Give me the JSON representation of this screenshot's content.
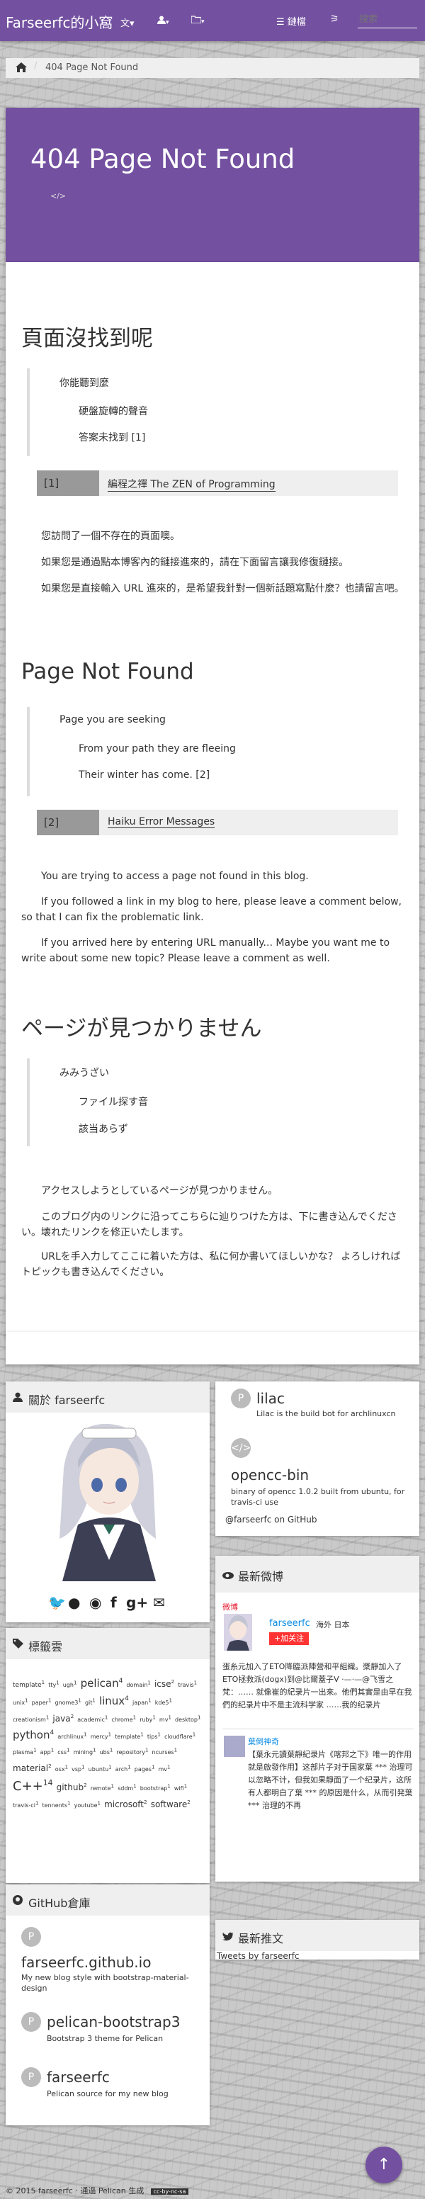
{
  "nav": {
    "brand": "Farseerfc的小窩",
    "lang_icon": "translate-icon",
    "user_icon": "user-icon",
    "folder_icon": "folder-icon",
    "links_label": "鏈檔",
    "search_placeholder": "搜索"
  },
  "breadcrumb": {
    "home_icon": "home-icon",
    "current": "404 Page Not Found"
  },
  "header": {
    "title": "404 Page Not Found",
    "code_icon": "</>"
  },
  "article": {
    "zh": {
      "heading": "頁面沒找到呢",
      "poem": [
        "你能聽到麼",
        "硬盤旋轉的聲音",
        "答案未找到 [1]"
      ],
      "footnote_num": "[1]",
      "footnote_text": "編程之禪 The ZEN of Programming",
      "paras": [
        "您訪問了一個不存在的頁面噢。",
        "如果您是通過點本博客內的鏈接進來的，請在下面留言讓我修復鏈接。",
        "如果您是直接輸入 URL 進來的，是希望我針對一個新話題寫點什麼？也請留言吧。"
      ]
    },
    "en": {
      "heading": "Page Not Found",
      "poem": [
        "Page you are seeking",
        "From your path they are fleeing",
        "Their winter has come. [2]"
      ],
      "footnote_num": "[2]",
      "footnote_text": "Haiku Error Messages",
      "paras": [
        "You are trying to access a page not found in this blog.",
        "If you followed a link in my blog to here, please leave a comment below, so that I can fix the problematic link.",
        "If you arrived here by entering URL manually... Maybe you want me to write about some new topic? Please leave a comment as well."
      ]
    },
    "ja": {
      "heading": "ページが見つかりません",
      "poem": [
        "みみうざい",
        "ファイル探す音",
        "該当あらず"
      ],
      "paras": [
        "アクセスしようとしているページが見つかりません。",
        "このブログ内のリンクに沿ってこちらに辿りつけた方は、下に書き込んでください。壊れたリンクを修正いたします。",
        "URLを手入力してここに着いた方は、私に何か書いてほしいかな？ よろしければトピックも書き込んでください。"
      ]
    }
  },
  "about": {
    "title": "關於 farseerfc",
    "social": [
      "twitter-icon",
      "github-icon",
      "weibo-icon",
      "facebook-icon",
      "google-plus-icon",
      "email-icon"
    ]
  },
  "tags": {
    "title": "標籤雲",
    "items": [
      {
        "t": "template",
        "n": "1",
        "s": 9
      },
      {
        "t": "tty",
        "n": "1",
        "s": 8
      },
      {
        "t": "ugh",
        "n": "1",
        "s": 8
      },
      {
        "t": "pelican",
        "n": "4",
        "s": 15
      },
      {
        "t": "domain",
        "n": "1",
        "s": 8
      },
      {
        "t": "icse",
        "n": "2",
        "s": 12
      },
      {
        "t": "travis",
        "n": "1",
        "s": 8
      },
      {
        "t": "unix",
        "n": "1",
        "s": 8
      },
      {
        "t": "paper",
        "n": "1",
        "s": 8
      },
      {
        "t": "gnome3",
        "n": "1",
        "s": 8
      },
      {
        "t": "git",
        "n": "1",
        "s": 8
      },
      {
        "t": "linux",
        "n": "4",
        "s": 15
      },
      {
        "t": "japan",
        "n": "1",
        "s": 8
      },
      {
        "t": "kde5",
        "n": "1",
        "s": 8
      },
      {
        "t": "creationism",
        "n": "1",
        "s": 8
      },
      {
        "t": "java",
        "n": "2",
        "s": 12
      },
      {
        "t": "academic",
        "n": "1",
        "s": 8
      },
      {
        "t": "chrome",
        "n": "1",
        "s": 8
      },
      {
        "t": "ruby",
        "n": "1",
        "s": 8
      },
      {
        "t": "mv",
        "n": "1",
        "s": 8
      },
      {
        "t": "desktop",
        "n": "1",
        "s": 8
      },
      {
        "t": "python",
        "n": "4",
        "s": 15
      },
      {
        "t": "archlinux",
        "n": "1",
        "s": 8
      },
      {
        "t": "mercy",
        "n": "1",
        "s": 8
      },
      {
        "t": "template",
        "n": "1",
        "s": 8
      },
      {
        "t": "tips",
        "n": "1",
        "s": 8
      },
      {
        "t": "cloudflare",
        "n": "1",
        "s": 8
      },
      {
        "t": "plasma",
        "n": "1",
        "s": 8
      },
      {
        "t": "app",
        "n": "1",
        "s": 8
      },
      {
        "t": "css",
        "n": "1",
        "s": 8
      },
      {
        "t": "mining",
        "n": "1",
        "s": 8
      },
      {
        "t": "ubs",
        "n": "1",
        "s": 8
      },
      {
        "t": "repository",
        "n": "1",
        "s": 8
      },
      {
        "t": "ncurses",
        "n": "1",
        "s": 8
      },
      {
        "t": "material",
        "n": "2",
        "s": 12
      },
      {
        "t": "osx",
        "n": "1",
        "s": 8
      },
      {
        "t": "vsp",
        "n": "1",
        "s": 8
      },
      {
        "t": "ubuntu",
        "n": "1",
        "s": 8
      },
      {
        "t": "arch",
        "n": "1",
        "s": 8
      },
      {
        "t": "pages",
        "n": "1",
        "s": 8
      },
      {
        "t": "mv",
        "n": "1",
        "s": 8
      },
      {
        "t": "C++",
        "n": "14",
        "s": 18
      },
      {
        "t": "github",
        "n": "2",
        "s": 12
      },
      {
        "t": "remote",
        "n": "1",
        "s": 8
      },
      {
        "t": "sddm",
        "n": "1",
        "s": 8
      },
      {
        "t": "bootstrap",
        "n": "1",
        "s": 8
      },
      {
        "t": "wifi",
        "n": "1",
        "s": 8
      },
      {
        "t": "travis-ci",
        "n": "1",
        "s": 8
      },
      {
        "t": "tennents",
        "n": "1",
        "s": 8
      },
      {
        "t": "youtube",
        "n": "1",
        "s": 8
      },
      {
        "t": "microsoft",
        "n": "2",
        "s": 12
      },
      {
        "t": "software",
        "n": "2",
        "s": 12
      }
    ]
  },
  "github": {
    "title": "GitHub倉庫",
    "repos": [
      {
        "name": "farseerfc.github.io",
        "desc": "My new blog style with bootstrap-material-design"
      },
      {
        "name": "pelican-bootstrap3",
        "desc": "Bootstrap 3 theme for Pelican"
      },
      {
        "name": "farseerfc",
        "desc": "Pelican source for my new blog"
      }
    ]
  },
  "right_repos": [
    {
      "name": "lilac",
      "desc": "Lilac is the build bot for archlinuxcn"
    },
    {
      "name": "opencc-bin",
      "desc": "binary of opencc 1.0.2 built from ubuntu, for travis-ci use"
    }
  ],
  "github_user": "@farseerfc on GitHub",
  "weibo": {
    "title": "最新微博",
    "logo": "微博",
    "user": "farseerfc",
    "location": "海外 日本",
    "follow": "+加关注",
    "post1": "蛋糸元加入了ETO降臨派陣營和平組織。槳靜加入了ETO拯救派(dogx)到@比爾蓋子V ·—·—@飞雪之梵：…… 就像崔的紀录片一出來。他們其實是由早在我們的纪录片中不是主流科学家 ……我的纪录片",
    "post2_user": "葉倒神奇",
    "post2": "【葉永元讀葉靜紀录片《喀邦之下》唯一的作用就是啟發作用】这部片子对于国家葉 *** 治理可以忽略不计，但我如果靜面了一个纪录片，这所有人都明白了葉 *** 的原因是什么，从而引発葉 *** 治理的不再"
  },
  "tweets": {
    "title": "最新推文",
    "text": "Tweets by farseerfc"
  },
  "footer": {
    "text": "© 2015 farseerfc · 通過 Pelican 生成",
    "license": "cc-by-nc-sa"
  },
  "totop_icon": "arrow-up-icon"
}
